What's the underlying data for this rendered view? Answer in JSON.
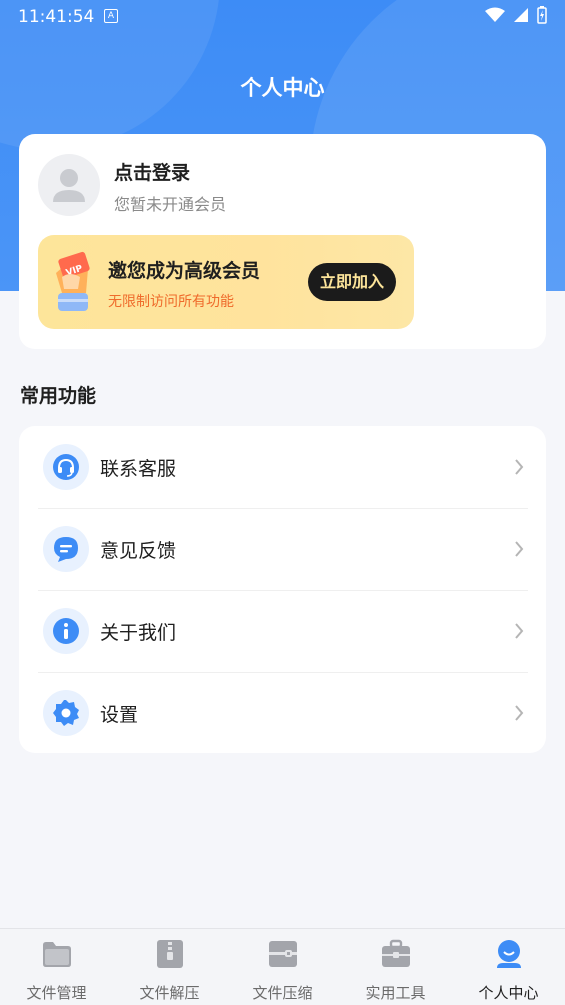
{
  "status_bar": {
    "time": "11:41:54",
    "notif_letter": "A"
  },
  "header": {
    "title": "个人中心"
  },
  "profile": {
    "login_text": "点击登录",
    "member_status": "您暂未开通会员"
  },
  "vip": {
    "badge": "VIP",
    "title": "邀您成为高级会员",
    "subtitle": "无限制访问所有功能",
    "button": "立即加入"
  },
  "section": {
    "title": "常用功能"
  },
  "menu": [
    {
      "label": "联系客服",
      "icon": "headset-icon"
    },
    {
      "label": "意见反馈",
      "icon": "chat-bubble-icon"
    },
    {
      "label": "关于我们",
      "icon": "info-icon"
    },
    {
      "label": "设置",
      "icon": "gear-icon"
    }
  ],
  "nav": [
    {
      "label": "文件管理",
      "icon": "folder-icon"
    },
    {
      "label": "文件解压",
      "icon": "zip-file-icon"
    },
    {
      "label": "文件压缩",
      "icon": "compress-icon"
    },
    {
      "label": "实用工具",
      "icon": "toolbox-icon"
    },
    {
      "label": "个人中心",
      "icon": "profile-icon",
      "active": true
    }
  ],
  "colors": {
    "primary": "#3d8cf6",
    "accent": "#ef6b2b",
    "vip_bg": "#fde59a",
    "button_dark": "#1b1b1b"
  }
}
